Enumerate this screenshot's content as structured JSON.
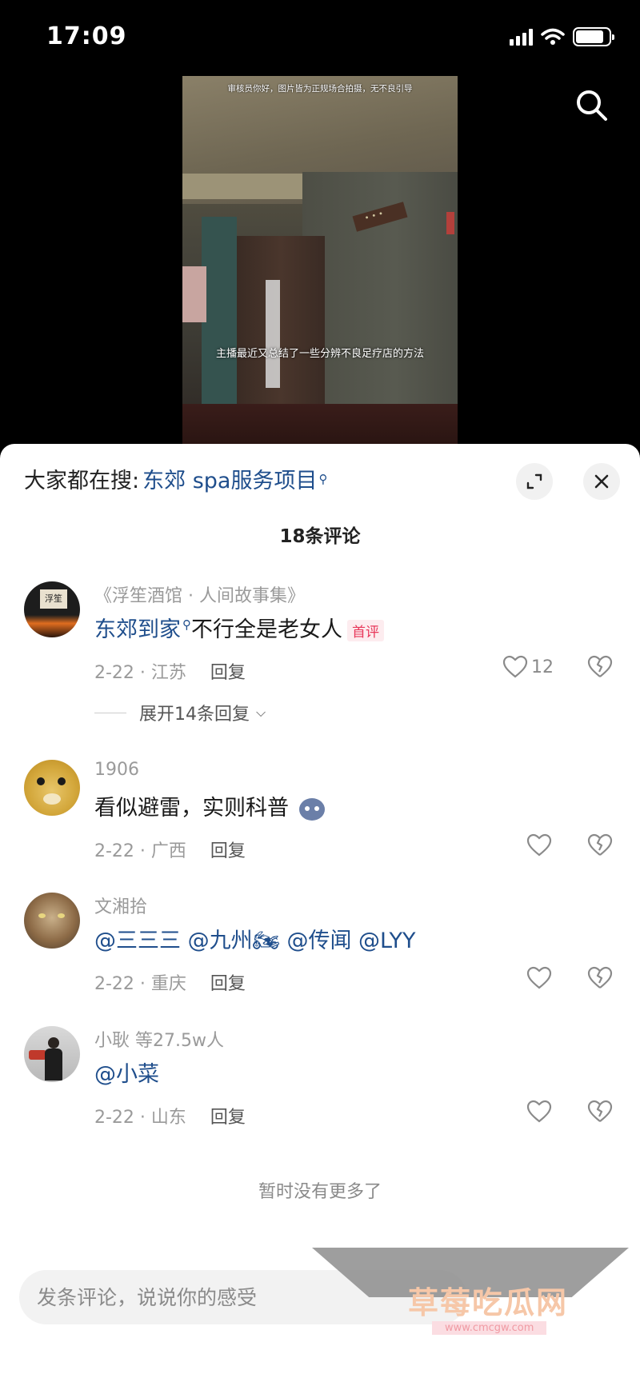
{
  "status_bar": {
    "time": "17:09",
    "battery_level": 0.85
  },
  "video": {
    "top_caption": "审核员你好，图片皆为正规场合拍摄，无不良引导",
    "subtitle": "主播最近又总结了一些分辨不良足疗店的方法"
  },
  "search_icon": "search-icon",
  "sheet": {
    "suggest_prefix": "大家都在搜:",
    "suggest_link": "东郊 spa服务项目",
    "comment_count": "18条评论",
    "end_note": "暂时没有更多了",
    "input_placeholder": "发条评论，说说你的感受"
  },
  "comments": [
    {
      "user": "《浮笙酒馆 · 人间故事集》",
      "text_link": "东郊到家",
      "text": "不行全是老女人",
      "badge": "首评",
      "date_location": "2-22 · 江苏",
      "reply_label": "回复",
      "likes": "12",
      "expand_replies": "展开14条回复"
    },
    {
      "user": "1906",
      "text": "看似避雷，实则科普",
      "date_location": "2-22 · 广西",
      "reply_label": "回复"
    },
    {
      "user": "文湘拾",
      "text": "@三三三 @九州🏍 @传闻 @LYY",
      "date_location": "2-22 · 重庆",
      "reply_label": "回复"
    },
    {
      "user": "小耿  等27.5w人",
      "text": "@小菜",
      "date_location": "2-22 · 山东",
      "reply_label": "回复"
    }
  ],
  "watermark": {
    "title": "草莓吃瓜网",
    "url": "www.cmcgw.com"
  },
  "colors": {
    "link": "#1f4e8c",
    "badge": "#e8375a",
    "muted": "#9a9a9a"
  }
}
